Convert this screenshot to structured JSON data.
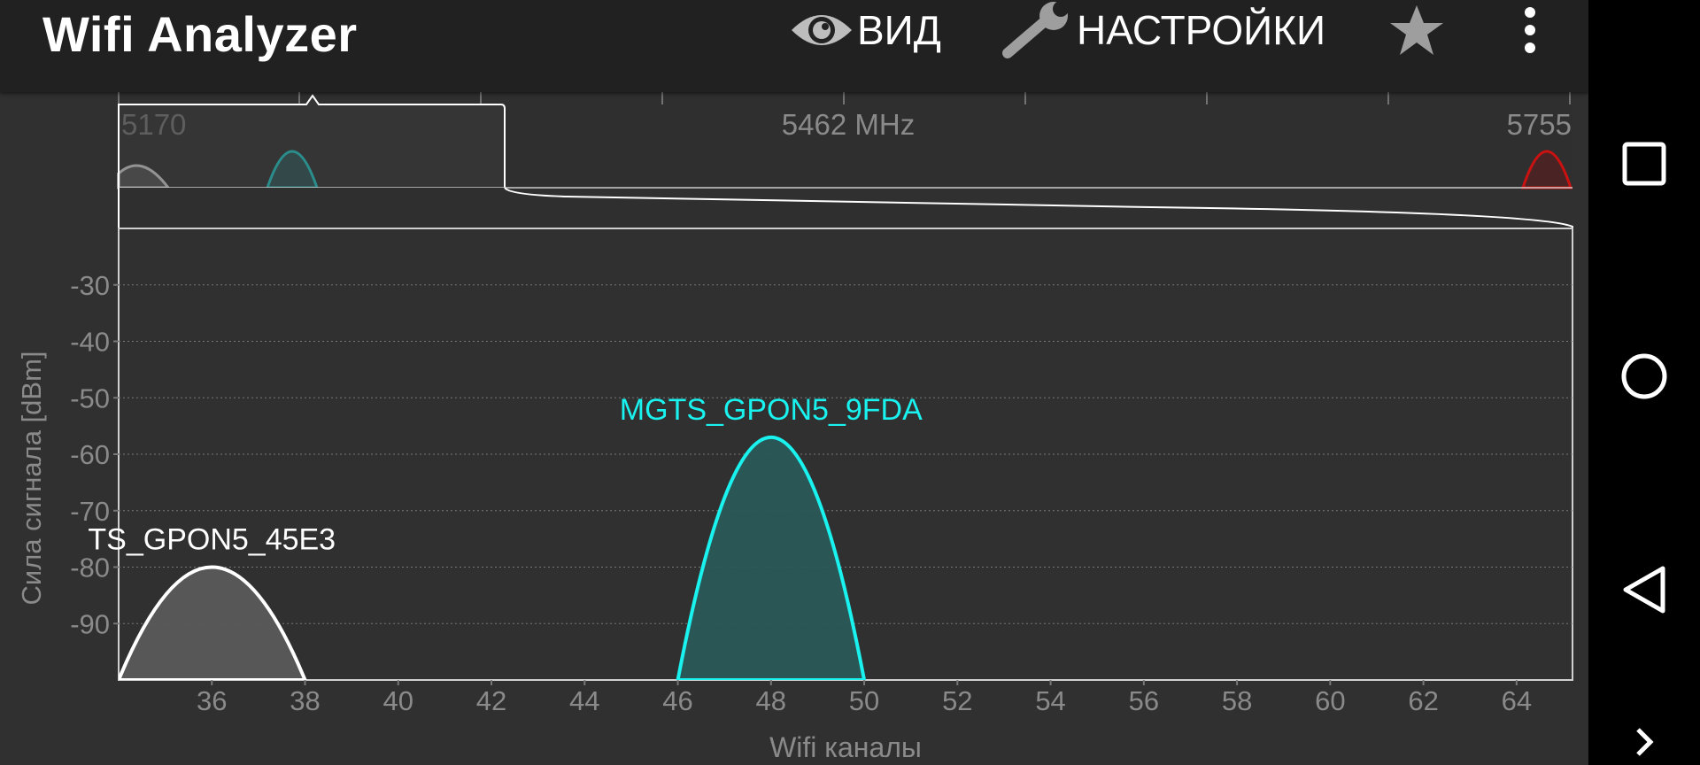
{
  "app": {
    "title": "Wifi Analyzer"
  },
  "toolbar": {
    "view_label": "ВИД",
    "settings_label": "НАСТРОЙКИ",
    "favorite_icon": "star-icon",
    "overflow_icon": "more-vert-icon"
  },
  "navbar": {
    "icons": [
      "recents-square-icon",
      "home-circle-icon",
      "back-triangle-icon",
      "chevron-right-icon"
    ]
  },
  "overview": {
    "freq_labels": [
      "5170",
      "5462 MHz",
      "5755"
    ],
    "freq_values": [
      5170,
      5462,
      5755
    ]
  },
  "colors": {
    "white_network": "#ffffff",
    "cyan_network": "#19f2ee",
    "red_network": "#cc1111",
    "grid": "#777777",
    "axis_text": "#8a8a8a"
  },
  "chart_data": {
    "type": "area",
    "xlabel": "Wifi каналы",
    "ylabel": "Сила сигнала [dBm]",
    "x_ticks": [
      36,
      38,
      40,
      42,
      44,
      46,
      48,
      50,
      52,
      54,
      56,
      58,
      60,
      62,
      64
    ],
    "y_ticks": [
      -30,
      -40,
      -50,
      -60,
      -70,
      -80,
      -90
    ],
    "xlim": [
      34,
      65.2
    ],
    "ylim": [
      -100,
      -20
    ],
    "grid": true,
    "series": [
      {
        "name": "TS_GPON5_45E3",
        "channel": 36,
        "half_width": 2,
        "signal": -80,
        "color": "#ffffff",
        "fill": "#5a5a5a"
      },
      {
        "name": "MGTS_GPON5_9FDA",
        "channel": 48,
        "half_width": 2,
        "signal": -57,
        "color": "#19f2ee",
        "fill": "#2a5a59"
      }
    ]
  }
}
